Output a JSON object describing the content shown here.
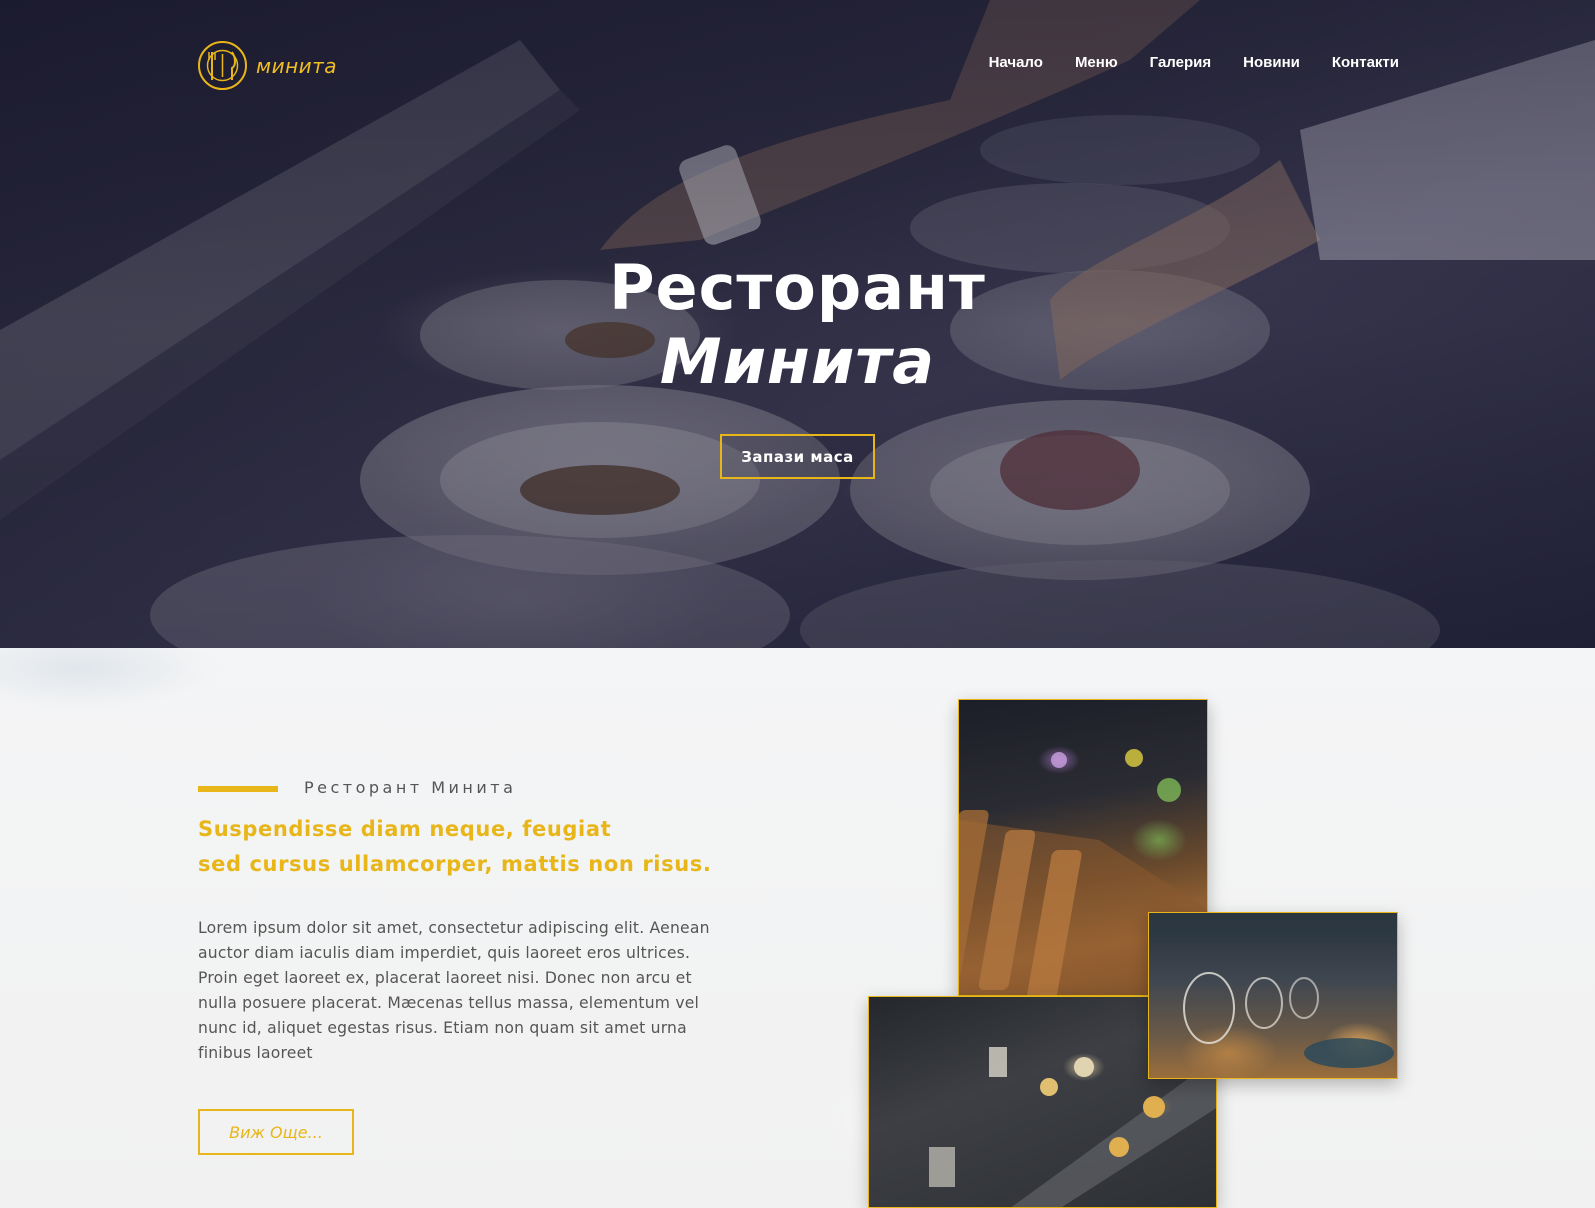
{
  "brand": {
    "name": "минита",
    "accent_color": "#e8b619",
    "logo_icon": "fork-knife-plate-icon"
  },
  "nav": {
    "items": [
      {
        "label": "Начало"
      },
      {
        "label": "Меню"
      },
      {
        "label": "Галерия"
      },
      {
        "label": "Новини"
      },
      {
        "label": "Контакти"
      }
    ]
  },
  "hero": {
    "title_line1": "Ресторант",
    "title_line2": "Минита",
    "cta_label": "Запази маса"
  },
  "about": {
    "eyebrow": "Ресторант Минита",
    "headline_line1": "Suspendisse diam neque, feugiat",
    "headline_line2": "sed cursus ullamcorper, mattis non risus.",
    "body": "Lorem ipsum dolor sit amet, consectetur adipiscing elit. Aenean auctor diam iaculis diam imperdiet, quis laoreet eros ultrices. Proin eget laoreet ex, placerat laoreet nisi. Donec non arcu et nulla posuere placerat. Mæcenas tellus massa, elementum vel nunc id, aliquet egestas risus. Etiam non quam sit amet urna finibus laoreet",
    "more_label": "Виж Още..."
  }
}
